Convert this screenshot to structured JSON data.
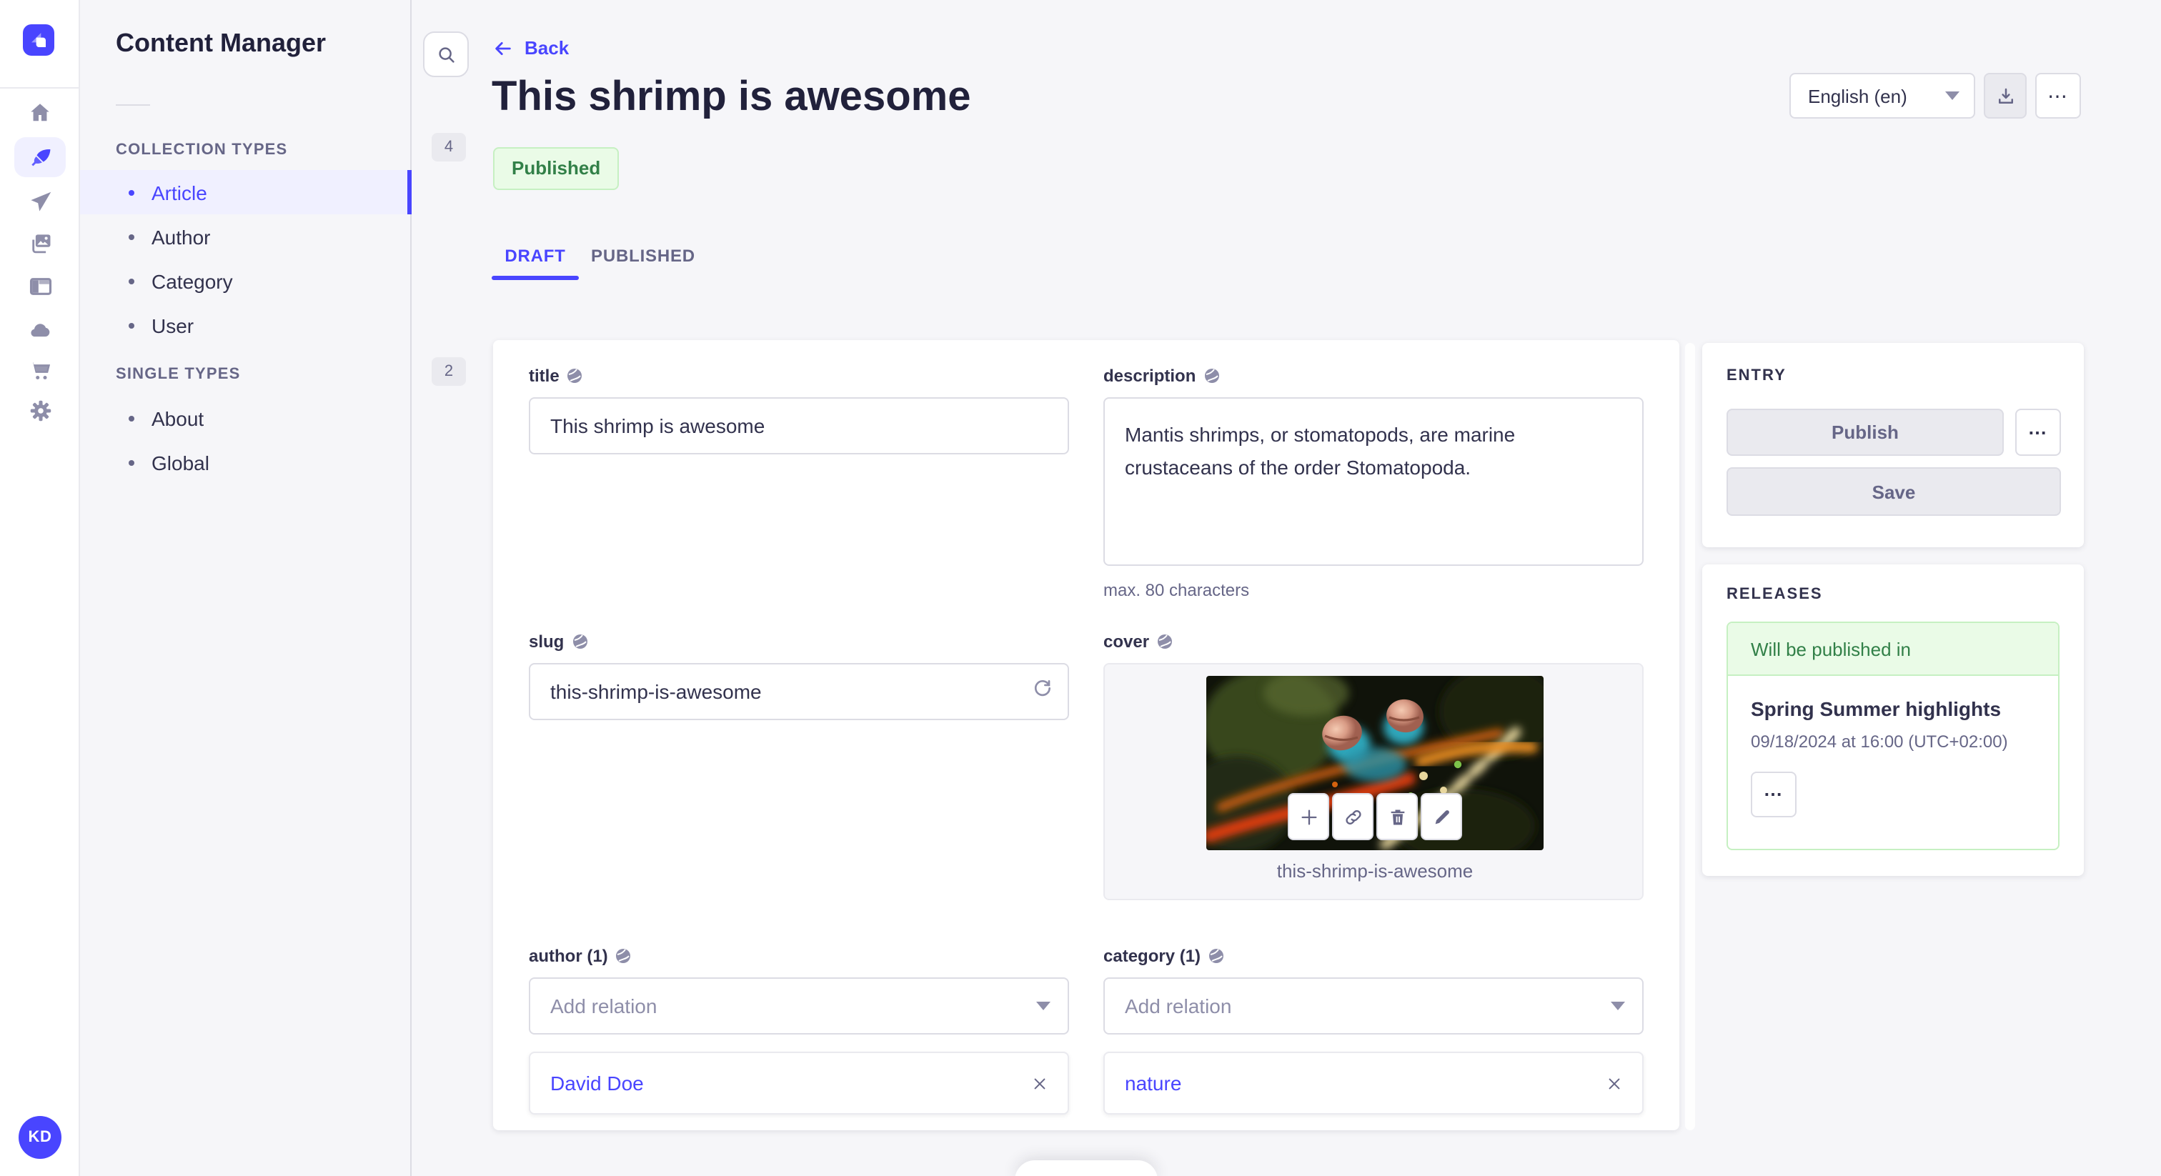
{
  "app": {
    "name": "Strapi admin",
    "logo_icon": "strapi-logo",
    "avatar_initials": "KD"
  },
  "rail": {
    "items": [
      {
        "icon": "home-icon",
        "active": false
      },
      {
        "icon": "content-manager-feather-icon",
        "active": true
      },
      {
        "icon": "deploy-plane-icon",
        "active": false
      },
      {
        "icon": "media-library-icon",
        "active": false
      },
      {
        "icon": "content-type-builder-icon",
        "active": false
      },
      {
        "icon": "cloud-icon",
        "active": false
      },
      {
        "icon": "marketplace-cart-icon",
        "active": false
      },
      {
        "icon": "settings-gear-icon",
        "active": false
      }
    ]
  },
  "subnav": {
    "title": "Content Manager",
    "search_icon": "search-icon",
    "sections": [
      {
        "label": "COLLECTION TYPES",
        "count": "4",
        "items": [
          {
            "label": "Article",
            "active": true
          },
          {
            "label": "Author"
          },
          {
            "label": "Category"
          },
          {
            "label": "User"
          }
        ]
      },
      {
        "label": "SINGLE TYPES",
        "count": "2",
        "items": [
          {
            "label": "About"
          },
          {
            "label": "Global"
          }
        ]
      }
    ]
  },
  "header": {
    "back_label": "Back",
    "title": "This shrimp is awesome",
    "status_badge": "Published",
    "locale_selector": "English (en)",
    "more_icon": "⋯"
  },
  "tabs": {
    "draft": "DRAFT",
    "published": "PUBLISHED"
  },
  "form": {
    "title": {
      "label": "title",
      "value": "This shrimp is awesome"
    },
    "description": {
      "label": "description",
      "value": "Mantis shrimps, or stomatopods, are marine crustaceans of the order Stomatopoda.",
      "hint": "max. 80 characters"
    },
    "slug": {
      "label": "slug",
      "value": "this-shrimp-is-awesome"
    },
    "cover": {
      "label": "cover",
      "caption": "this-shrimp-is-awesome",
      "toolbar_icons": [
        "plus-icon",
        "link-icon",
        "trash-icon",
        "pencil-icon"
      ]
    },
    "author": {
      "label": "author (1)",
      "placeholder": "Add relation",
      "relation": "David Doe"
    },
    "category": {
      "label": "category (1)",
      "placeholder": "Add relation",
      "relation": "nature"
    }
  },
  "entry_panel": {
    "heading": "ENTRY",
    "publish_label": "Publish",
    "save_label": "Save",
    "more_icon": "⋯"
  },
  "releases_panel": {
    "heading": "RELEASES",
    "status": "Will be published in",
    "release_title": "Spring Summer highlights",
    "release_date": "09/18/2024 at 16:00 (UTC+02:00)",
    "more_icon": "⋯"
  },
  "colors": {
    "primary": "#4945FF",
    "primary_light": "#F0F0FF",
    "success_text": "#328048",
    "success_bg": "#EAFBE7",
    "success_border": "#C6F0C2",
    "background": "#F6F6F9",
    "border": "#DCDCE4",
    "text": "#32324D",
    "muted": "#666687",
    "placeholder": "#8E8EA9"
  }
}
